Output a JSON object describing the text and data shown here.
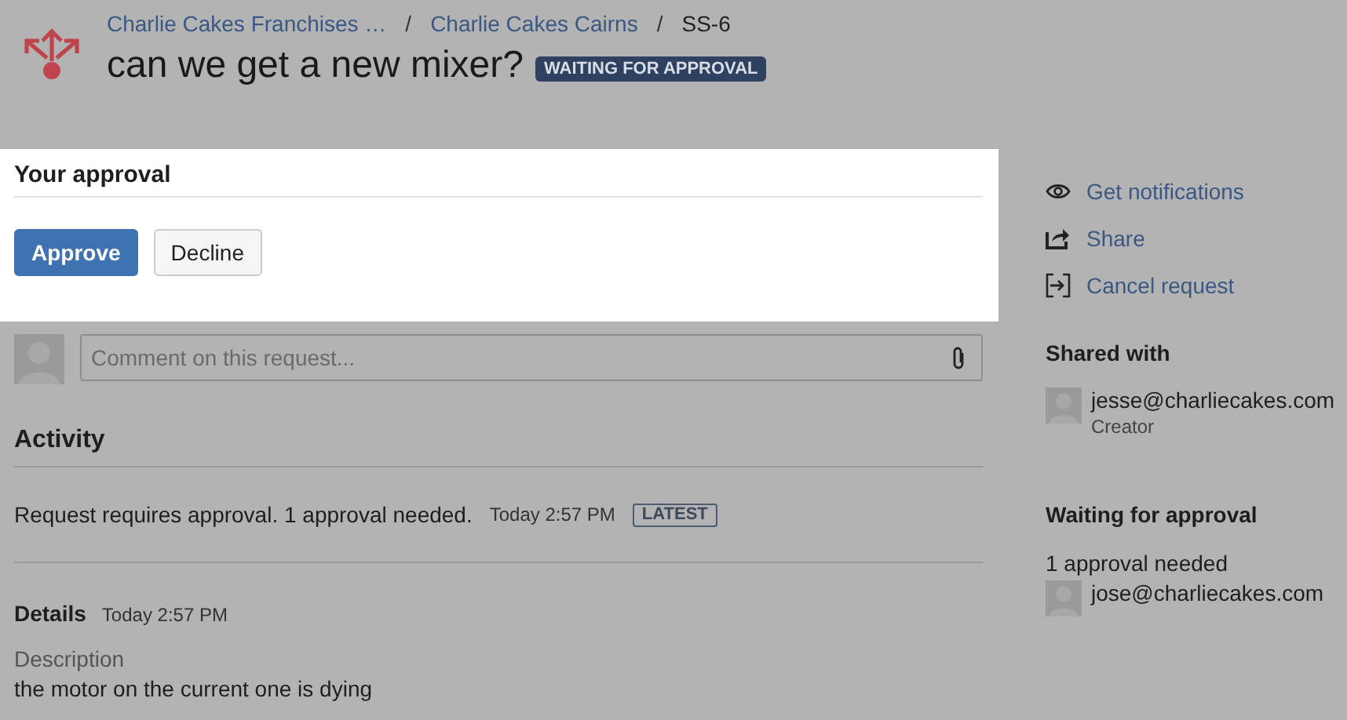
{
  "breadcrumbs": [
    "Charlie Cakes Franchises …",
    "Charlie Cakes Cairns",
    "SS-6"
  ],
  "breadcrumb_separator": "/",
  "title": "can we get a new mixer?",
  "status": "WAITING FOR APPROVAL",
  "approval": {
    "heading": "Your approval",
    "buttons": [
      {
        "label": "Approve",
        "kind": "primary"
      },
      {
        "label": "Decline",
        "kind": "default"
      }
    ]
  },
  "comment": {
    "placeholder": "Comment on this request..."
  },
  "activity": {
    "heading": "Activity",
    "entries": [
      {
        "text": "Request requires approval. 1 approval needed.",
        "time": "Today 2:57 PM",
        "badge": "LATEST"
      }
    ]
  },
  "details": {
    "heading": "Details",
    "time": "Today 2:57 PM",
    "label": "Description",
    "value": "the motor on the current one is dying"
  },
  "actions": [
    {
      "kind": "eye",
      "label": "Get notifications"
    },
    {
      "kind": "share",
      "label": "Share"
    },
    {
      "kind": "cancel",
      "label": "Cancel request"
    }
  ],
  "shared_with": {
    "heading": "Shared with",
    "users": [
      {
        "email": "jesse@charliecakes.com",
        "role": "Creator"
      }
    ]
  },
  "waiting": {
    "heading": "Waiting for approval",
    "note": "1 approval needed",
    "users": [
      {
        "email": "jose@charliecakes.com"
      }
    ]
  }
}
